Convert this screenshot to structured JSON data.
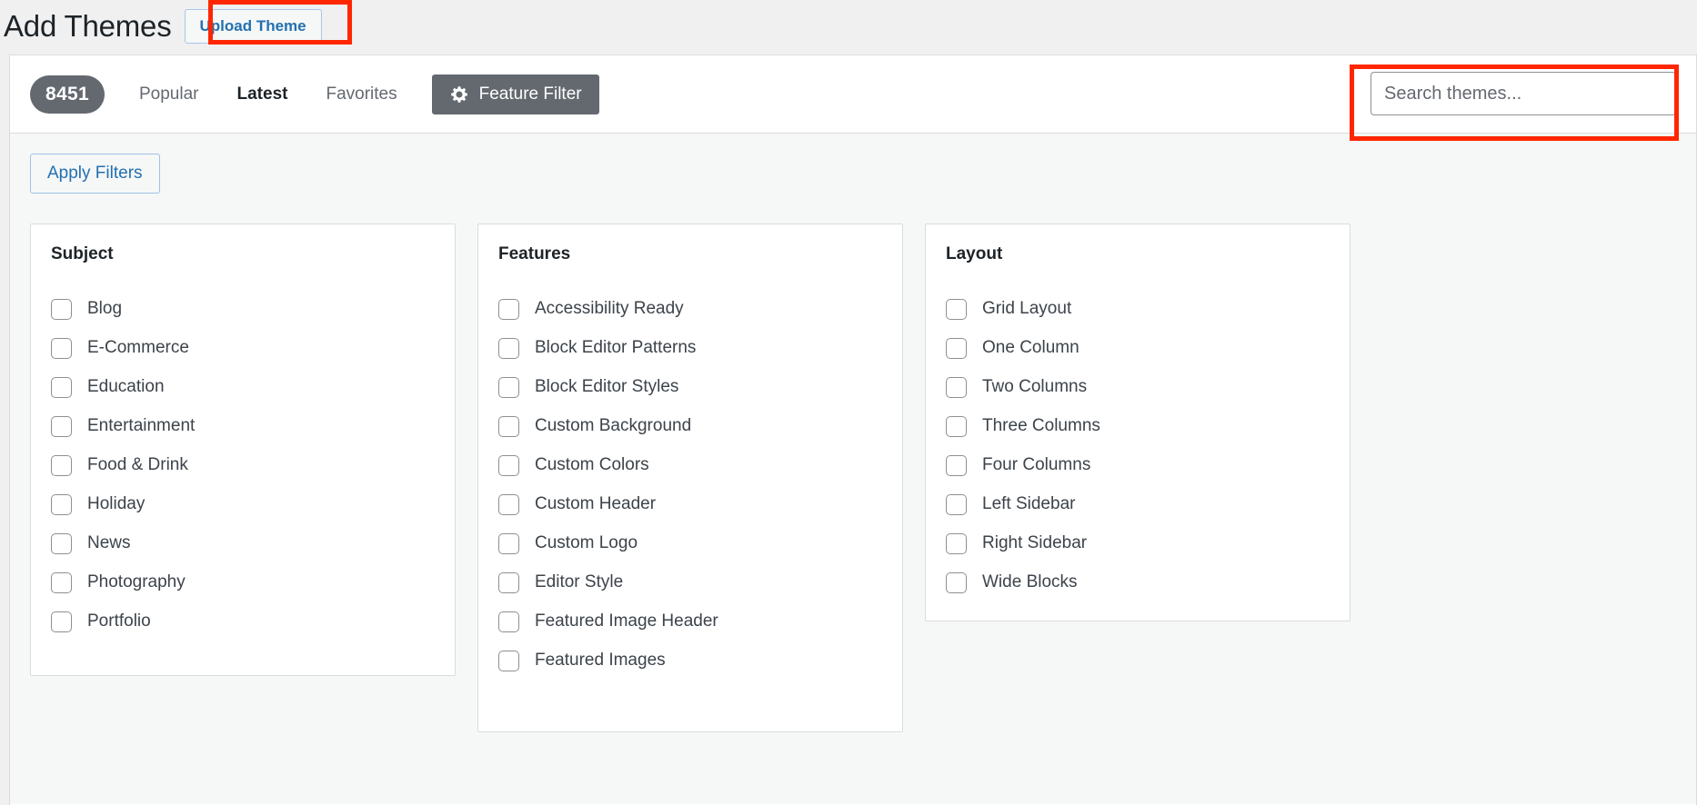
{
  "header": {
    "title": "Add Themes",
    "upload_button": "Upload Theme"
  },
  "filter_bar": {
    "theme_count": "8451",
    "tabs": [
      {
        "label": "Popular",
        "current": false
      },
      {
        "label": "Latest",
        "current": true
      },
      {
        "label": "Favorites",
        "current": false
      }
    ],
    "feature_filter_button": "Feature Filter",
    "feature_filter_icon": "gear-icon",
    "search": {
      "placeholder": "Search themes...",
      "value": ""
    }
  },
  "filter_drawer": {
    "apply_filters_button": "Apply Filters",
    "groups": [
      {
        "title": "Subject",
        "options": [
          "Blog",
          "E-Commerce",
          "Education",
          "Entertainment",
          "Food & Drink",
          "Holiday",
          "News",
          "Photography",
          "Portfolio"
        ]
      },
      {
        "title": "Features",
        "options": [
          "Accessibility Ready",
          "Block Editor Patterns",
          "Block Editor Styles",
          "Custom Background",
          "Custom Colors",
          "Custom Header",
          "Custom Logo",
          "Editor Style",
          "Featured Image Header",
          "Featured Images"
        ]
      },
      {
        "title": "Layout",
        "options": [
          "Grid Layout",
          "One Column",
          "Two Columns",
          "Three Columns",
          "Four Columns",
          "Left Sidebar",
          "Right Sidebar",
          "Wide Blocks"
        ]
      }
    ]
  },
  "annotations": {
    "accent_color": "#ff2600",
    "highlighted": [
      "upload-theme-button",
      "search-themes-input"
    ]
  },
  "colors": {
    "page_background": "#f0f0f1",
    "panel_background": "#ffffff",
    "drawer_background": "#f6f7f7",
    "link_blue": "#2271b1",
    "badge_gray": "#646970",
    "border_gray": "#dcdcde",
    "text_dark": "#1d2327",
    "text_muted": "#3c434a"
  }
}
